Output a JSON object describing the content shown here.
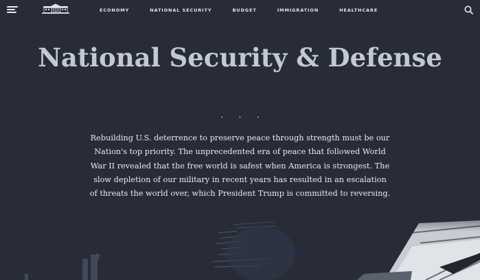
{
  "header": {
    "menu_icon": "hamburger-menu-icon",
    "logo_icon": "white-house-logo-icon",
    "search_icon": "search-icon",
    "nav": [
      {
        "label": "ECONOMY"
      },
      {
        "label": "NATIONAL SECURITY"
      },
      {
        "label": "BUDGET"
      },
      {
        "label": "IMMIGRATION"
      },
      {
        "label": "HEALTHCARE"
      }
    ]
  },
  "hero": {
    "title": "National Security & Defense",
    "divider": "• • •",
    "body": "Rebuilding U.S. deterrence to preserve peace through strength must be our Nation's top priority. The unprecedented era of peace that followed World War II revealed that the free world is safest when America is strongest. The slow depletion of our military in recent years has resulted in an escalation of threats the world over, which President Trump is committed to reversing."
  },
  "colors": {
    "background": "#272c38",
    "title": "#c2c8d4",
    "text": "#e9ebef"
  }
}
